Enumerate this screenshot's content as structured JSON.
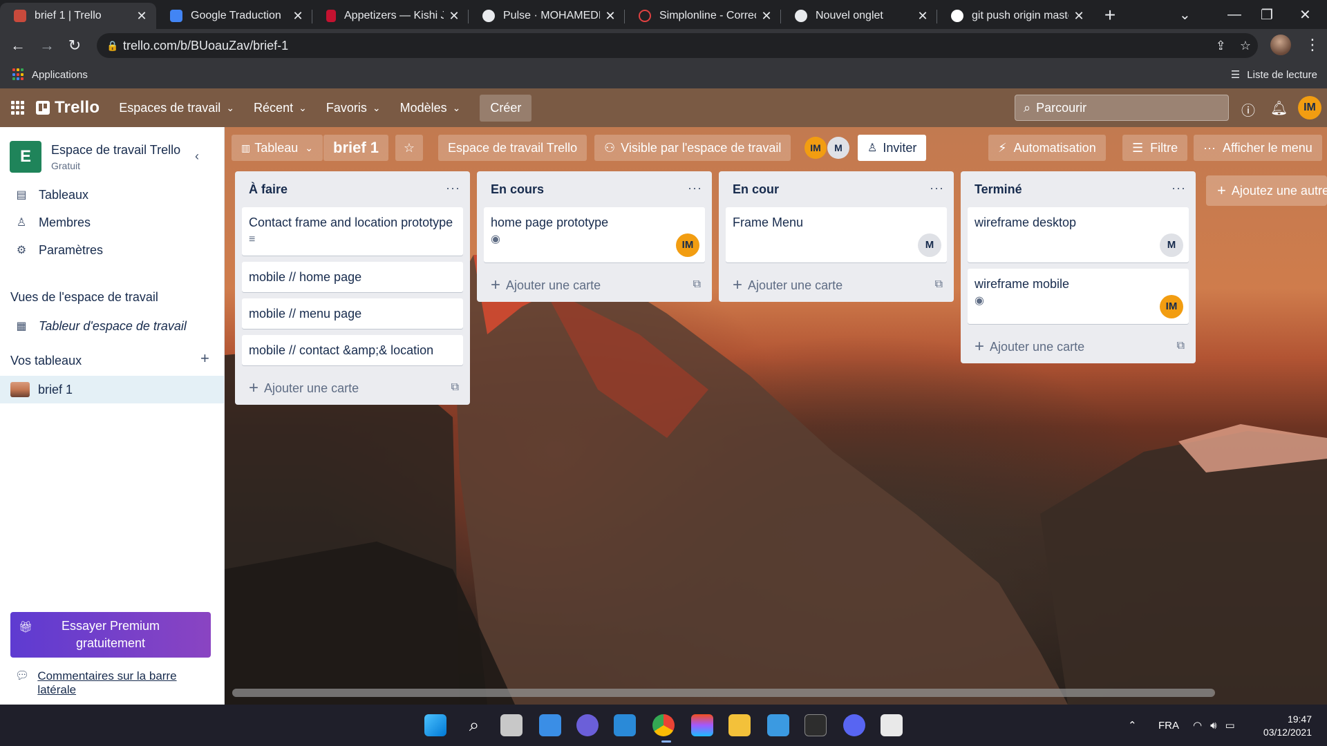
{
  "browser": {
    "tabs": [
      {
        "title": "brief 1 | Trello",
        "favicon_color": "#c94a3c",
        "active": true
      },
      {
        "title": "Google Traduction",
        "favicon_color": "#4285f4",
        "active": false
      },
      {
        "title": "Appetizers — Kishi Ja",
        "favicon_color": "#c41230",
        "active": false
      },
      {
        "title": "Pulse · MOHAMEDIBN",
        "favicon_color": "#e8eaed",
        "active": false
      },
      {
        "title": "Simplonline - Correcti",
        "favicon_color": "#e04141",
        "active": false
      },
      {
        "title": "Nouvel onglet",
        "favicon_color": "#e8eaed",
        "active": false
      },
      {
        "title": "git push origin maste",
        "favicon_color": "#ffffff",
        "active": false
      }
    ],
    "url": "trello.com/b/BUoauZav/brief-1",
    "bookmarks": {
      "apps_label": "Applications",
      "reading_list_label": "Liste de lecture"
    }
  },
  "trello_header": {
    "logo": "Trello",
    "menus": [
      {
        "label": "Espaces de travail"
      },
      {
        "label": "Récent"
      },
      {
        "label": "Favoris"
      },
      {
        "label": "Modèles"
      }
    ],
    "create_label": "Créer",
    "search_placeholder": "Parcourir",
    "user_initials": "IM",
    "bg_color": "#7a5a44"
  },
  "sidebar": {
    "workspace_initial": "E",
    "workspace_name": "Espace de travail Trello",
    "workspace_plan": "Gratuit",
    "nav": [
      {
        "label": "Tableaux",
        "icon": "board-icon"
      },
      {
        "label": "Membres",
        "icon": "person-icon"
      },
      {
        "label": "Paramètres",
        "icon": "gear-icon"
      }
    ],
    "views_heading": "Vues de l'espace de travail",
    "views": [
      {
        "label": "Tableur d'espace de travail",
        "icon": "table-icon"
      }
    ],
    "boards_heading": "Vos tableaux",
    "boards": [
      {
        "label": "brief 1"
      }
    ],
    "premium_label": "Essayer Premium gratuitement",
    "feedback_label": "Commentaires sur la barre latérale"
  },
  "board_header": {
    "view_label": "Tableau",
    "board_name": "brief 1",
    "workspace_label": "Espace de travail Trello",
    "visibility_label": "Visible par l'espace de travail",
    "members": [
      "IM",
      "M"
    ],
    "invite_label": "Inviter",
    "automation_label": "Automatisation",
    "filter_label": "Filtre",
    "menu_label": "Afficher le menu"
  },
  "lists": [
    {
      "title": "À faire",
      "cards": [
        {
          "title": "Contact frame and location prototype",
          "has_description": true
        },
        {
          "title": "mobile // home page"
        },
        {
          "title": "mobile // menu page"
        },
        {
          "title": "mobile // contact &amp;& location"
        }
      ],
      "add_label": "Ajouter une carte"
    },
    {
      "title": "En cours",
      "cards": [
        {
          "title": "home page prototype",
          "watching": true,
          "member": "IM"
        }
      ],
      "add_label": "Ajouter une carte"
    },
    {
      "title": "En cour",
      "cards": [
        {
          "title": "Frame Menu",
          "member": "M"
        }
      ],
      "add_label": "Ajouter une carte"
    },
    {
      "title": "Terminé",
      "cards": [
        {
          "title": "wireframe desktop",
          "member": "M"
        },
        {
          "title": "wireframe mobile",
          "watching": true,
          "member": "IM"
        }
      ],
      "add_label": "Ajouter une carte"
    }
  ],
  "add_list_label": "Ajoutez une autre",
  "taskbar": {
    "language": "FRA",
    "time": "19:47",
    "date": "03/12/2021"
  }
}
